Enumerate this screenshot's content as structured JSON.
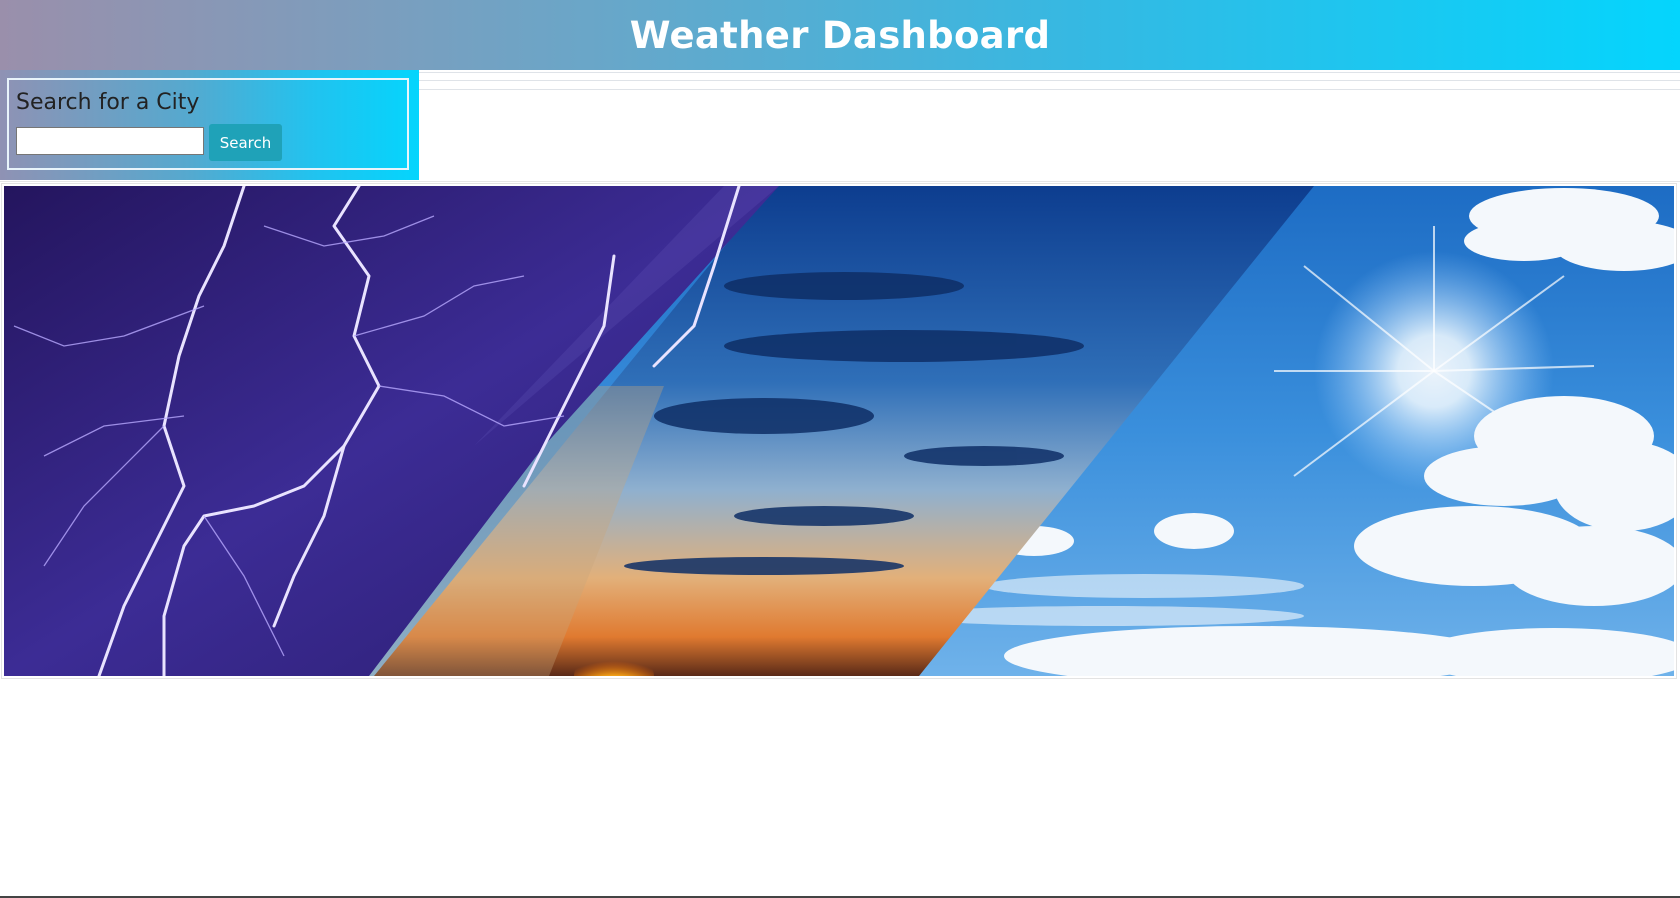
{
  "header": {
    "title": "Weather Dashboard"
  },
  "search": {
    "title": "Search for a City",
    "input_value": "",
    "input_placeholder": "",
    "button_label": "Search"
  },
  "hero": {
    "panels": [
      "storm-lightning",
      "sunset-sky",
      "sunny-clouds"
    ]
  },
  "colors": {
    "header_gradient_start": "#9a8fab",
    "header_gradient_end": "#04d5fd",
    "button_bg": "#1fa2b8",
    "storm_purple": "#3a2a8a",
    "sky_blue": "#2f7fd0"
  }
}
